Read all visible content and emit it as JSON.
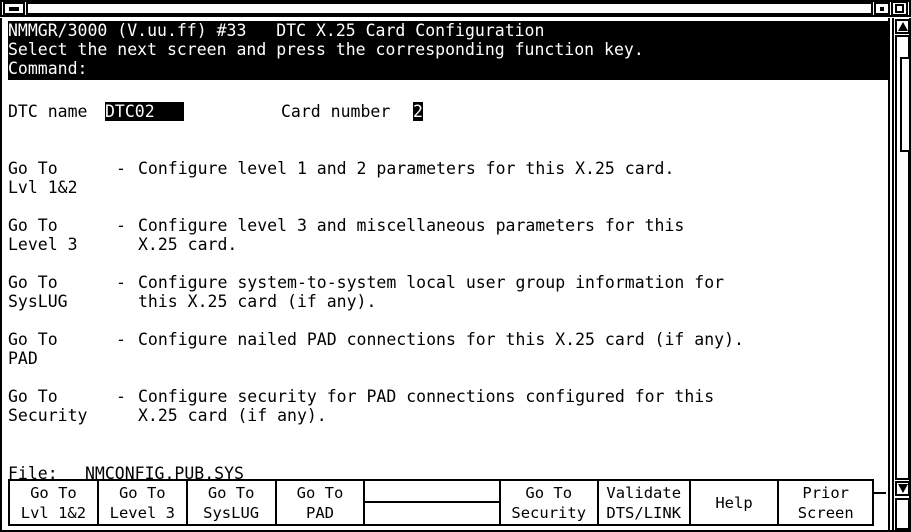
{
  "window": {
    "title": "",
    "menu_button": "window-menu",
    "minimize_button": "minimize",
    "maximize_button": "maximize"
  },
  "terminal": {
    "header": {
      "line1": "NMMGR/3000 (V.uu.ff) #33   DTC X.25 Card Configuration",
      "line2": "Select the next screen and press the corresponding function key.",
      "line3_label": "Command:",
      "line3_value": ""
    },
    "fields": {
      "dtc_name_label": "DTC name",
      "dtc_name_value": "DTC02   ",
      "card_number_label": "Card number",
      "card_number_value": "2"
    },
    "menu_items": [
      {
        "key_line1": "Go To",
        "key_line2": "Lvl 1&2",
        "dash": "-",
        "desc_line1": "Configure level 1 and 2 parameters for this X.25 card.",
        "desc_line2": ""
      },
      {
        "key_line1": "Go To",
        "key_line2": "Level 3",
        "dash": "-",
        "desc_line1": "Configure level 3 and miscellaneous parameters for this",
        "desc_line2": "X.25 card."
      },
      {
        "key_line1": "Go To",
        "key_line2": "SysLUG",
        "dash": "-",
        "desc_line1": "Configure system-to-system local user group information for",
        "desc_line2": "this X.25 card (if any)."
      },
      {
        "key_line1": "Go To",
        "key_line2": "PAD",
        "dash": "-",
        "desc_line1": "Configure nailed PAD connections for this X.25 card (if any).",
        "desc_line2": ""
      },
      {
        "key_line1": "Go To",
        "key_line2": "Security",
        "dash": "-",
        "desc_line1": "Configure security for PAD connections configured for this",
        "desc_line2": "X.25 card (if any)."
      }
    ],
    "file_line": {
      "label": "File:",
      "value": "NMCONFIG.PUB.SYS"
    }
  },
  "function_keys": [
    {
      "line1": "Go To",
      "line2": "Lvl 1&2"
    },
    {
      "line1": "Go To",
      "line2": "Level 3"
    },
    {
      "line1": "Go To",
      "line2": "SysLUG"
    },
    {
      "line1": "Go To",
      "line2": "PAD"
    },
    {
      "line1": "",
      "line2": ""
    },
    {
      "line1": "Go To",
      "line2": "Security"
    },
    {
      "line1": "Validate",
      "line2": "DTS/LINK"
    },
    {
      "line1": "Help",
      "line2": ""
    },
    {
      "line1": "Prior",
      "line2": "Screen"
    }
  ],
  "colors": {
    "background": "#ffffff",
    "foreground": "#000000",
    "inverse_bg": "#000000",
    "inverse_fg": "#ffffff"
  }
}
